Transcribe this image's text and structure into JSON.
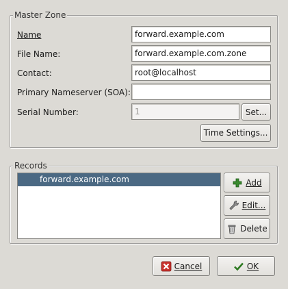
{
  "master_zone": {
    "title": "Master Zone",
    "name_label": "Name",
    "name_value": "forward.example.com",
    "filename_label": "File Name:",
    "filename_value": "forward.example.com.zone",
    "contact_label": "Contact:",
    "contact_value": "root@localhost",
    "nameserver_label": "Primary Nameserver (SOA):",
    "nameserver_value": "",
    "serial_label": "Serial Number:",
    "serial_value": "1",
    "set_button": "Set...",
    "time_settings_button": "Time Settings..."
  },
  "records": {
    "title": "Records",
    "items": [
      "forward.example.com"
    ],
    "add_button": "Add",
    "edit_button": "Edit...",
    "delete_button": "Delete"
  },
  "dialog": {
    "cancel_button": "Cancel",
    "ok_button": "OK"
  },
  "colors": {
    "selection": "#4b6983",
    "background": "#dcdad5"
  },
  "icons": {
    "add": "plus-icon",
    "edit": "wrench-icon",
    "delete": "trash-icon",
    "cancel": "cancel-icon",
    "ok": "checkmark-icon"
  }
}
